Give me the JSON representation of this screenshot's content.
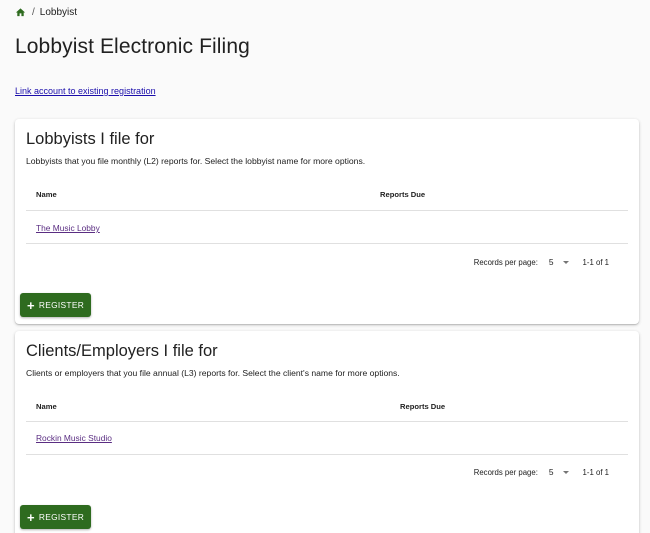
{
  "breadcrumb": {
    "current": "Lobbyist"
  },
  "page": {
    "title": "Lobbyist Electronic Filing",
    "link_account": "Link account to existing registration"
  },
  "lobbyists": {
    "title": "Lobbyists I file for",
    "subtitle": "Lobbyists that you file monthly (L2) reports for. Select the lobbyist name for more options.",
    "columns": [
      "Name",
      "Reports Due"
    ],
    "rows": [
      {
        "name": "The Music Lobby",
        "reports_due": ""
      }
    ],
    "records_per_page_label": "Records per page:",
    "records_per_page": "5",
    "range": "1-1 of 1",
    "register_label": "REGISTER"
  },
  "clients": {
    "title": "Clients/Employers I file for",
    "subtitle": "Clients or employers that you file annual (L3) reports for. Select the client's name for more options.",
    "columns": [
      "Name",
      "Reports Due"
    ],
    "rows": [
      {
        "name": "Rockin Music Studio",
        "reports_due": ""
      }
    ],
    "records_per_page_label": "Records per page:",
    "records_per_page": "5",
    "range": "1-1 of 1",
    "register_label": "REGISTER"
  },
  "colors": {
    "primary_button": "#2e6b1f",
    "link": "#1a0dab",
    "visited_link": "#5a2d82"
  }
}
